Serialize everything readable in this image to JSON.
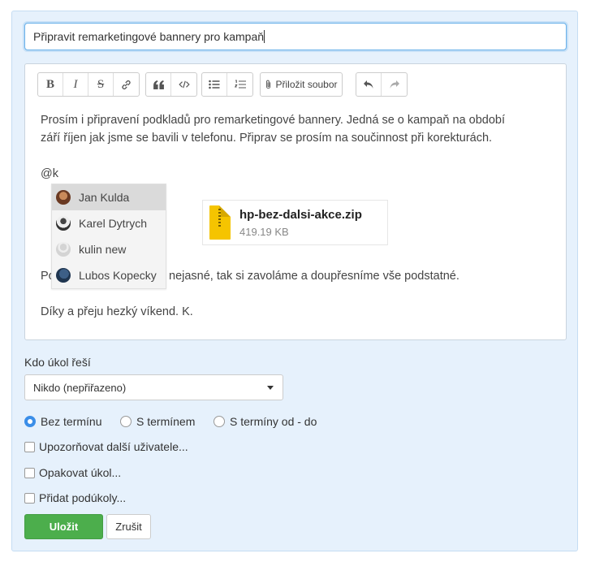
{
  "task": {
    "title_value": "Připravit remarketingové bannery pro kampaň"
  },
  "toolbar": {
    "bold": "B",
    "italic": "I",
    "strike": "S",
    "link_icon": "link-icon",
    "quote_icon": "quote-icon",
    "code_icon": "code-icon",
    "bullet_list_icon": "bullet-list-icon",
    "numbered_list_icon": "numbered-list-icon",
    "attach_label": "Přiložit soubor",
    "undo_icon": "undo-icon",
    "redo_icon": "redo-icon"
  },
  "editor": {
    "line1": "Prosím i připravení podkladů pro remarketingové bannery. Jedná se o kampaň na období",
    "line2": "září říjen jak jsme se bavili v telefonu. Připrav se prosím na součinnost při korekturách.",
    "mention_typed": "@k",
    "line3_start": "Po",
    "line3_rest": "nejasné, tak si zavoláme a doupřesníme vše podstatné.",
    "line4": "Díky a přeju hezký víkend. K."
  },
  "mentions": [
    {
      "name": "Jan Kulda",
      "active": true
    },
    {
      "name": "Karel Dytrych",
      "active": false
    },
    {
      "name": "kulin new",
      "active": false
    },
    {
      "name": "Lubos Kopecky",
      "active": false
    }
  ],
  "attachment": {
    "filename": "hp-bez-dalsi-akce.zip",
    "size": "419.19 KB"
  },
  "assignee": {
    "label": "Kdo úkol řeší",
    "selected": "Nikdo (nepřiřazeno)"
  },
  "deadline": {
    "options": [
      "Bez termínu",
      "S termínem",
      "S termíny od - do"
    ],
    "selected_index": 0
  },
  "checkboxes": {
    "notify": "Upozorňovat další uživatele...",
    "repeat": "Opakovat úkol...",
    "subtasks": "Přidat podúkoly..."
  },
  "buttons": {
    "save": "Uložit",
    "cancel": "Zrušit"
  },
  "colors": {
    "panel_bg": "#e6f1fc",
    "accent": "#3b8ee8",
    "save_green": "#4cae4c",
    "zip_yellow": "#f5c400"
  }
}
